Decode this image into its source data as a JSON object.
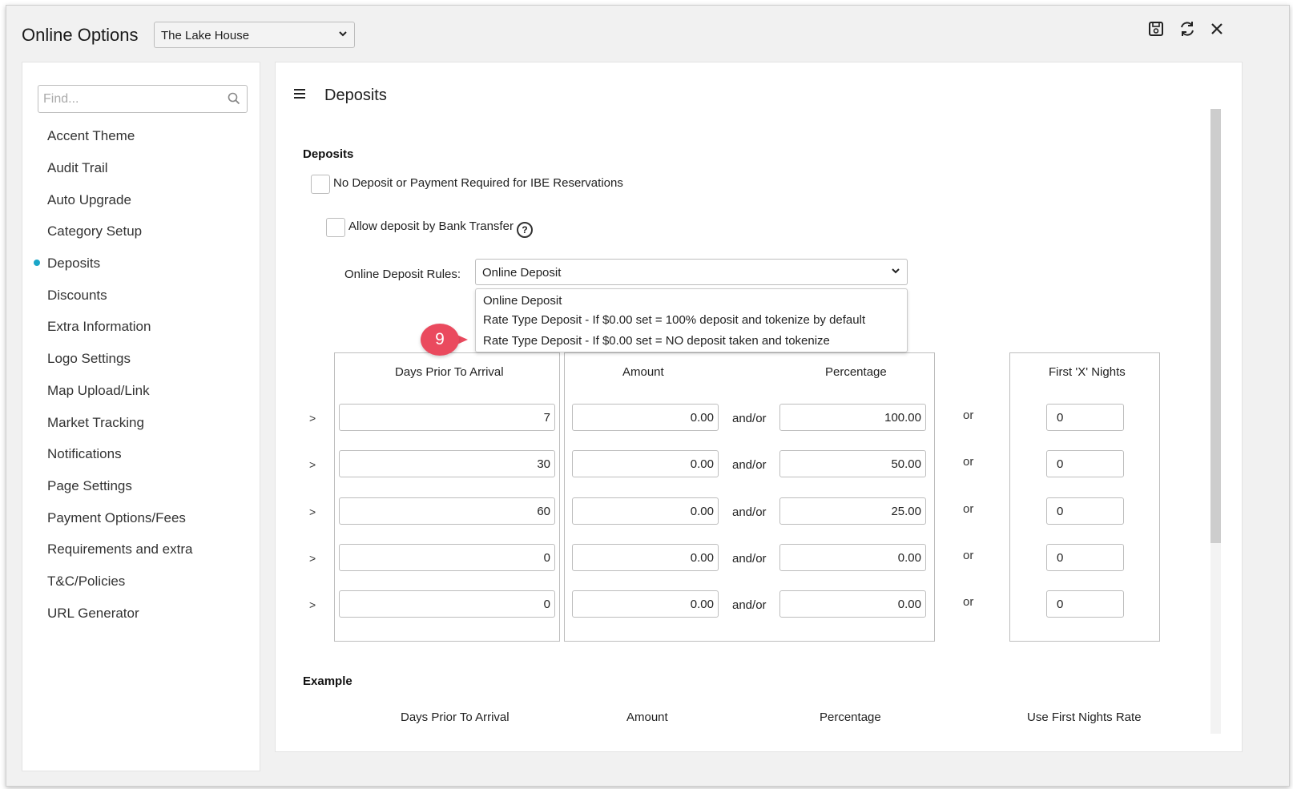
{
  "window": {
    "title": "Online Options",
    "property_select": {
      "value": "The Lake House"
    },
    "toolbar": {
      "save_icon": "floppy-disk-icon",
      "refresh_icon": "refresh-icon",
      "close_icon": "close-icon"
    }
  },
  "sidebar": {
    "search_placeholder": "Find...",
    "items": [
      {
        "label": "Accent Theme"
      },
      {
        "label": "Audit Trail"
      },
      {
        "label": "Auto Upgrade"
      },
      {
        "label": "Category Setup"
      },
      {
        "label": "Deposits",
        "active": true
      },
      {
        "label": "Discounts"
      },
      {
        "label": "Extra Information"
      },
      {
        "label": "Logo Settings"
      },
      {
        "label": "Map Upload/Link"
      },
      {
        "label": "Market Tracking"
      },
      {
        "label": "Notifications"
      },
      {
        "label": "Page Settings"
      },
      {
        "label": "Payment Options/Fees"
      },
      {
        "label": "Requirements and extra"
      },
      {
        "label": "T&C/Policies"
      },
      {
        "label": "URL Generator"
      }
    ],
    "active_color": "#1aa6c8"
  },
  "main": {
    "title": "Deposits",
    "section_label": "Deposits",
    "no_deposit_label": "No Deposit or Payment Required for IBE Reservations",
    "bank_transfer_label": "Allow deposit by Bank Transfer",
    "help_glyph": "?",
    "rules_label": "Online Deposit Rules:",
    "rules_value": "Online Deposit",
    "rules_options": [
      "Online Deposit",
      "Rate Type Deposit - If $0.00 set = 100% deposit and tokenize by default",
      "Rate Type Deposit - If $0.00 set = NO deposit taken and tokenize"
    ],
    "step_badge": "9",
    "badge_color": "#ea4a5e",
    "columns": {
      "days": "Days Prior To Arrival",
      "amount": "Amount",
      "percentage": "Percentage",
      "first_nights": "First 'X' Nights"
    },
    "rows": [
      {
        "arrow": ">",
        "days": "7",
        "amount": "0.00",
        "andor": "and/or",
        "percentage": "100.00",
        "or": "or",
        "nights": "0"
      },
      {
        "arrow": ">",
        "days": "30",
        "amount": "0.00",
        "andor": "and/or",
        "percentage": "50.00",
        "or": "or",
        "nights": "0"
      },
      {
        "arrow": ">",
        "days": "60",
        "amount": "0.00",
        "andor": "and/or",
        "percentage": "25.00",
        "or": "or",
        "nights": "0"
      },
      {
        "arrow": ">",
        "days": "0",
        "amount": "0.00",
        "andor": "and/or",
        "percentage": "0.00",
        "or": "or",
        "nights": "0"
      },
      {
        "arrow": ">",
        "days": "0",
        "amount": "0.00",
        "andor": "and/or",
        "percentage": "0.00",
        "or": "or",
        "nights": "0"
      }
    ],
    "example": {
      "label": "Example",
      "columns": [
        "Days Prior To Arrival",
        "Amount",
        "Percentage",
        "Use First Nights Rate"
      ]
    }
  }
}
